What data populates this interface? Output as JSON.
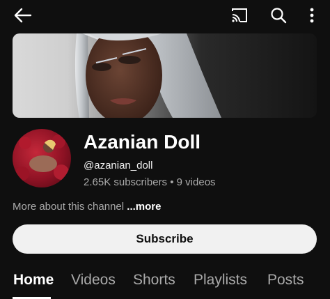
{
  "topbar": {
    "back_icon": "arrow-left-icon",
    "cast_icon": "cast-icon",
    "search_icon": "search-icon",
    "more_icon": "more-vertical-icon"
  },
  "channel": {
    "name": "Azanian Doll",
    "handle": "@azanian_doll",
    "subscribers": "2.65K subscribers",
    "separator": "•",
    "videos": "9 videos",
    "about_text": "More about this channel",
    "about_more": "...more"
  },
  "subscribe": {
    "label": "Subscribe"
  },
  "tabs": [
    {
      "label": "Home",
      "active": true
    },
    {
      "label": "Videos",
      "active": false
    },
    {
      "label": "Shorts",
      "active": false
    },
    {
      "label": "Playlists",
      "active": false
    },
    {
      "label": "Posts",
      "active": false
    }
  ],
  "colors": {
    "background": "#0f0f0f",
    "text_primary": "#ffffff",
    "text_secondary": "#aaaaaa",
    "button_bg": "#f1f1f1"
  }
}
